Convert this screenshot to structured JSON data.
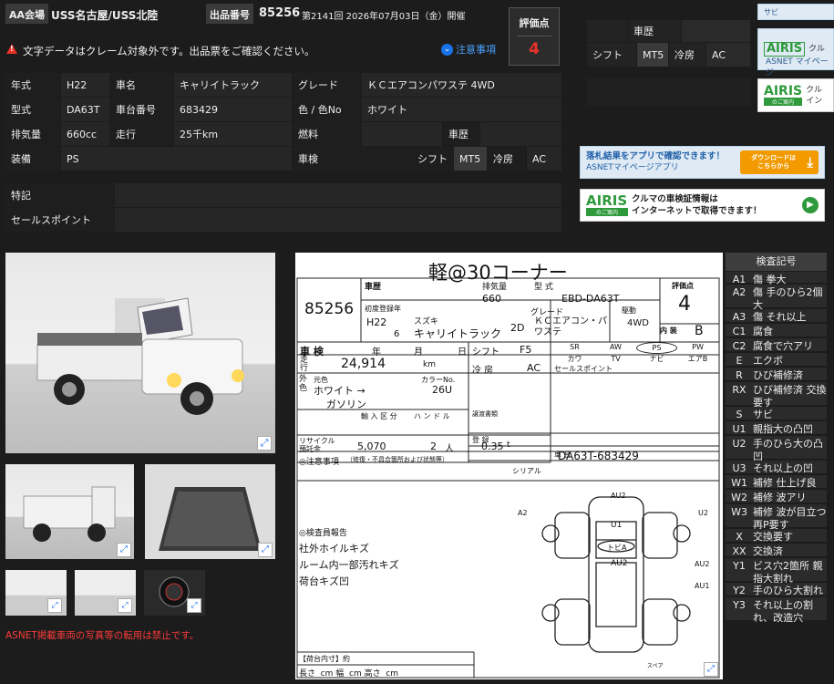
{
  "header": {
    "venue_label": "AA会場",
    "venue_value": "USS名古屋/USS北陸",
    "lot_label": "出品番号",
    "lot_value": "85256",
    "session_text": "第2141回 2026年07月03日（金）開催",
    "score_label": "評価点",
    "score_value": "4",
    "warning_text": "文字データはクレーム対象外です。出品票をご確認ください。",
    "notice_link": "注意事項"
  },
  "colors": {
    "accent": "#1a73e8",
    "score": "#e8332a",
    "airis_green": "#2e9a3c",
    "download_orange": "#f29a00"
  },
  "details": {
    "year_label": "年式",
    "year_value": "H22",
    "name_label": "車名",
    "name_value": "キャリイトラック",
    "grade_label": "グレード",
    "grade_value": "ＫＣエアコンパワステ 4WD",
    "model_label": "型式",
    "model_value": "DA63T",
    "chassis_label": "車台番号",
    "chassis_value": "683429",
    "color_label": "色 / 色No",
    "color_value": "ホワイト",
    "displacement_label": "排気量",
    "displacement_value": "660cc",
    "mileage_label": "走行",
    "mileage_value": "25千km",
    "fuel_label": "燃料",
    "fuel_value": "",
    "history_label": "車歴",
    "history_value": "",
    "equipment_label": "装備",
    "equipment_value": "PS",
    "inspection_label": "車検",
    "inspection_value": "",
    "shift_label": "シフト",
    "shift_value": "MT5",
    "ac_label": "冷房",
    "ac_value": "AC",
    "special_label": "特記",
    "special_value": "",
    "sales_label": "セールスポイント",
    "sales_value": ""
  },
  "side_panel": {
    "history_label": "車歴",
    "shift_label": "シフト",
    "shift_value": "MT5",
    "ac_label": "冷房",
    "ac_value": "AC",
    "banner_top": "サビ",
    "airis_text": "AIRIS",
    "airis_sub": "のご案内",
    "partial_1a": "クル",
    "partial_1b": "ASNET マイページ",
    "partial_2a": "クル",
    "partial_2b": "イン"
  },
  "banners": {
    "app_line1": "落札結果をアプリで確認できます！",
    "app_line2": "ASNETマイページアプリ",
    "download_line1": "ダウンロードは",
    "download_line2": "こちらから",
    "airis_line1": "クルマの車検証情報は",
    "airis_line2": "インターネットで取得できます！"
  },
  "photo_notice": "ASNET掲載車両の写真等の転用は禁止です。",
  "sheet": {
    "title": "軽@30コーナー",
    "lot": "85256",
    "history_label": "車歴",
    "displacement_label": "排気量",
    "displacement_value": "660",
    "type_label": "型 式",
    "type_value": "EBD-DA63T",
    "score_label": "評価点",
    "score_value": "4",
    "interior_label": "内 装",
    "interior_value": "B",
    "first_reg_label": "初度登録年",
    "year_value": "H22",
    "month_value": "6",
    "maker_value": "スズキ",
    "name_value": "キャリイトラック",
    "doors_value": "2D",
    "grade_label": "グレード",
    "grade_value": "ＫＣエアコン・パワステ",
    "drive_label": "駆動",
    "drive_value": "4WD",
    "inspection_label": "車 検",
    "year_unit": "年",
    "month_unit": "月",
    "day_unit": "日",
    "shift_label": "シフト",
    "shift_value": "F5",
    "options": [
      "SR",
      "AW",
      "PS",
      "PW",
      "カワ",
      "TV",
      "ナビ",
      "エアB"
    ],
    "mileage_label": "走行",
    "mileage_value": "24,914",
    "km_unit": "km",
    "ac_label": "冷 房",
    "ac_value": "AC",
    "sales_point_label": "セールスポイント",
    "outer_color_label": "外 色",
    "color_label": "元色",
    "color_value": "ホワイト →",
    "color_no_label": "カラーNo.",
    "color_no_value": "26U",
    "fuel_value": "ガソリン",
    "import_label": "輸 入 区 分",
    "handle_label": "ハ ン ド ル",
    "transfer_label": "譲渡書類",
    "until_label": "登 録",
    "recycle_label": "リサイクル預託金",
    "recycle_value": "5,070",
    "capacity_value": "2",
    "capacity_unit": "人",
    "load_value": "0.35",
    "load_unit": "t",
    "chassis_label": "車 台",
    "chassis_value": "DA63T-683429",
    "serial_label": "シリアル",
    "notes_label": "◎注意事項",
    "notes_paren": "（修復・不具合箇所および状態等）",
    "report_label": "◎検査員報告",
    "report_lines": [
      "社外ホイルキズ",
      "ルーム内一部汚れキズ",
      "荷台キズ凹"
    ],
    "diagram_marks": [
      "AU2",
      "U1",
      "トビA",
      "AU2",
      "A2",
      "U2",
      "AU2",
      "AU1"
    ],
    "bed_label": "【荷台内寸】約",
    "bed_row": "長さ  cm 幅  cm 高さ  cm",
    "spare_label": "スペア"
  },
  "inspection_legend": {
    "title": "検査記号",
    "rows": [
      {
        "code": "A1",
        "desc": "傷 拳大"
      },
      {
        "code": "A2",
        "desc": "傷 手のひら2個大"
      },
      {
        "code": "A3",
        "desc": "傷 それ以上"
      },
      {
        "code": "C1",
        "desc": "腐食"
      },
      {
        "code": "C2",
        "desc": "腐食で穴アリ"
      },
      {
        "code": "E",
        "desc": "エクボ"
      },
      {
        "code": "R",
        "desc": "ひび補修済"
      },
      {
        "code": "RX",
        "desc": "ひび補修済 交換要す"
      },
      {
        "code": "S",
        "desc": "サビ"
      },
      {
        "code": "U1",
        "desc": "親指大の凸凹"
      },
      {
        "code": "U2",
        "desc": "手のひら大の凸凹"
      },
      {
        "code": "U3",
        "desc": "それ以上の凹"
      },
      {
        "code": "W1",
        "desc": "補修 仕上げ良"
      },
      {
        "code": "W2",
        "desc": "補修 波アリ"
      },
      {
        "code": "W3",
        "desc": "補修 波が目立つ 再P要す"
      },
      {
        "code": "X",
        "desc": "交換要す"
      },
      {
        "code": "XX",
        "desc": "交換済"
      },
      {
        "code": "Y1",
        "desc": "ビス穴2箇所 親指大割れ"
      },
      {
        "code": "Y2",
        "desc": "手のひら大割れ"
      },
      {
        "code": "Y3",
        "desc": "それ以上の割れ、改造穴"
      }
    ]
  }
}
